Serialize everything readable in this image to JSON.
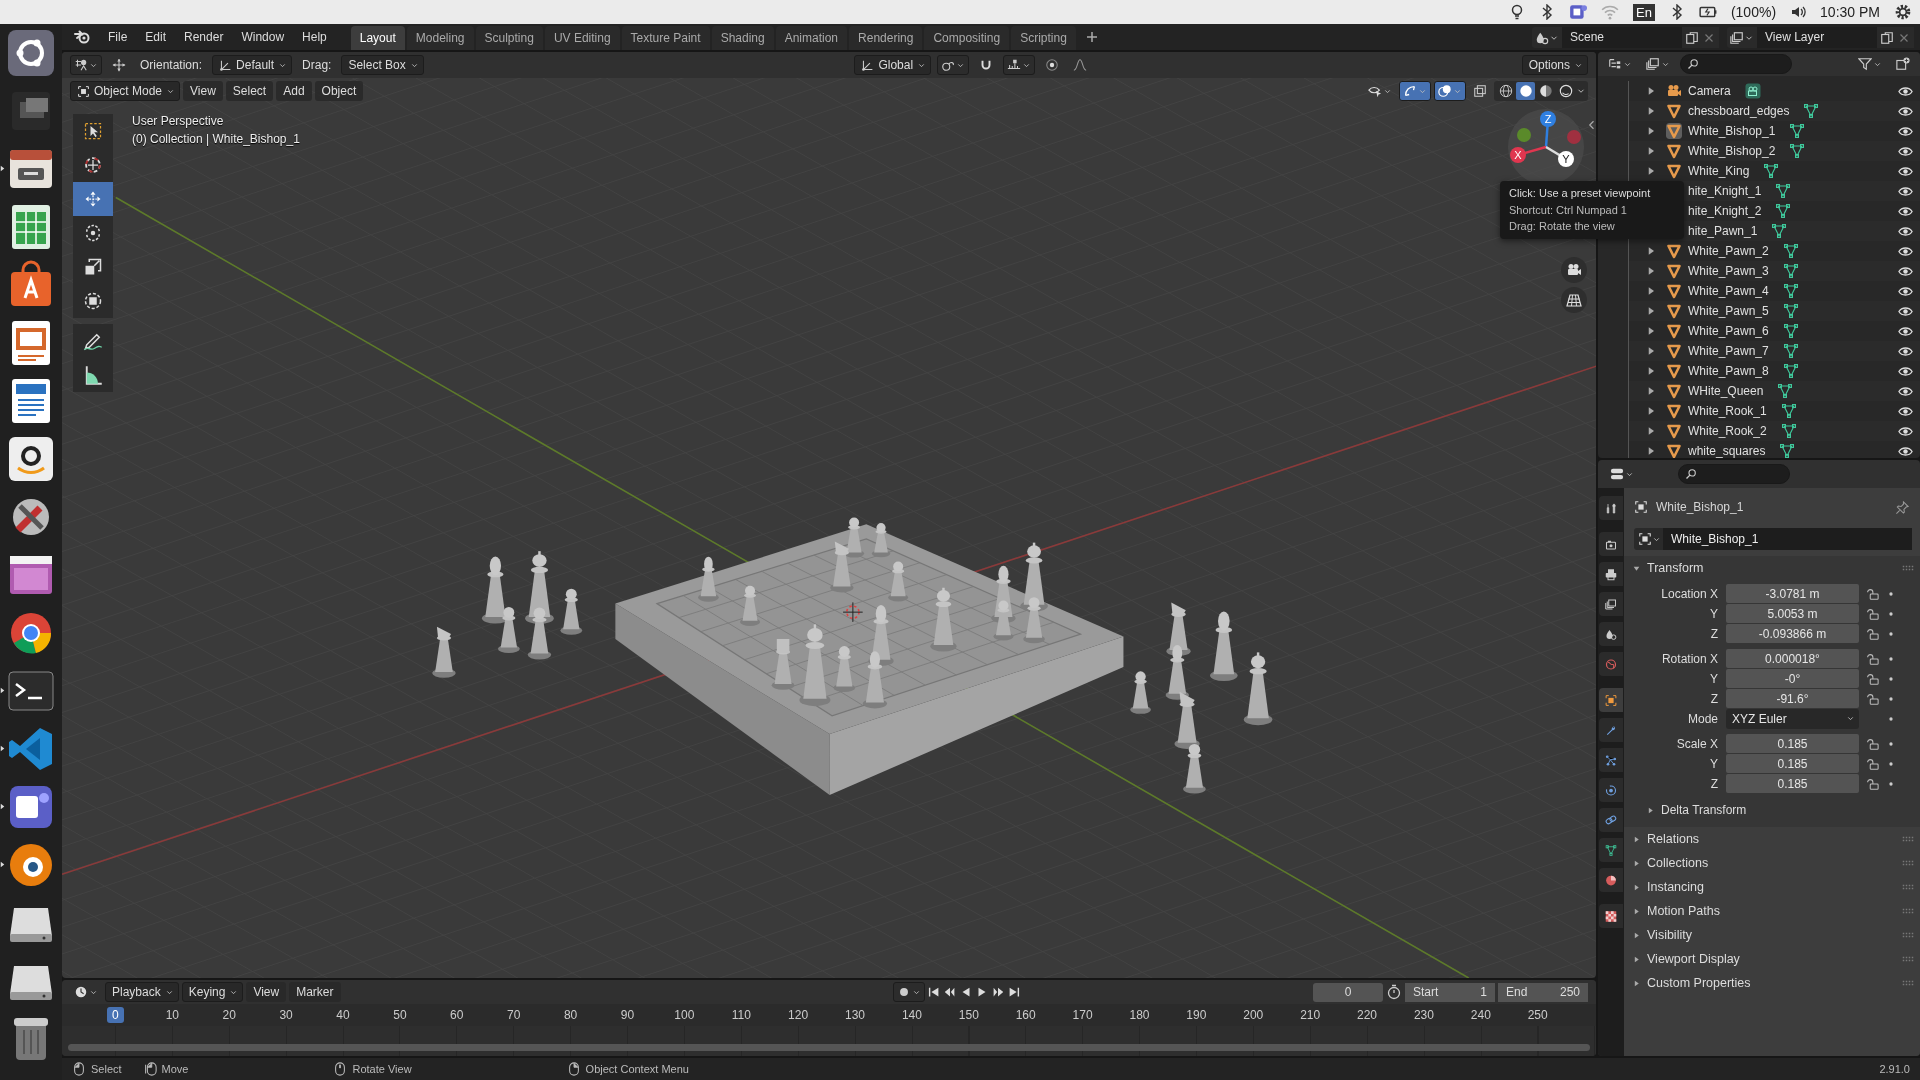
{
  "system_bar": {
    "keyboard": "En",
    "battery": "(100%)",
    "clock": "10:30 PM"
  },
  "dock": [
    {
      "kind": "ubuntu",
      "running": false
    },
    {
      "kind": "windows",
      "running": false
    },
    {
      "kind": "files",
      "running": true
    },
    {
      "kind": "calc",
      "running": false
    },
    {
      "kind": "software",
      "running": false
    },
    {
      "kind": "impress",
      "running": false
    },
    {
      "kind": "writer",
      "running": false
    },
    {
      "kind": "amazon",
      "running": false
    },
    {
      "kind": "settings",
      "running": false
    },
    {
      "kind": "purple",
      "running": false
    },
    {
      "kind": "chrome",
      "running": false
    },
    {
      "kind": "terminal",
      "running": true
    },
    {
      "kind": "vscode",
      "running": true
    },
    {
      "kind": "teams",
      "running": true
    },
    {
      "kind": "blender",
      "running": true
    },
    {
      "kind": "disk",
      "running": false
    },
    {
      "kind": "disk",
      "running": false
    },
    {
      "kind": "trash",
      "running": false
    }
  ],
  "menu": [
    "File",
    "Edit",
    "Render",
    "Window",
    "Help"
  ],
  "workspaces": [
    {
      "label": "Layout",
      "selected": true
    },
    {
      "label": "Modeling",
      "selected": false
    },
    {
      "label": "Sculpting",
      "selected": false
    },
    {
      "label": "UV Editing",
      "selected": false
    },
    {
      "label": "Texture Paint",
      "selected": false
    },
    {
      "label": "Shading",
      "selected": false
    },
    {
      "label": "Animation",
      "selected": false
    },
    {
      "label": "Rendering",
      "selected": false
    },
    {
      "label": "Compositing",
      "selected": false
    },
    {
      "label": "Scripting",
      "selected": false
    }
  ],
  "scene": "Scene",
  "view_layer": "View Layer",
  "tool_settings": {
    "orientation_label": "Orientation:",
    "orientation": "Default",
    "drag_label": "Drag:",
    "drag": "Select Box",
    "transform": "Global",
    "options": "Options"
  },
  "viewport_header": {
    "mode": "Object Mode",
    "menus": [
      "View",
      "Select",
      "Add",
      "Object"
    ],
    "shading": [
      {
        "kind": "wireframe",
        "selected": false
      },
      {
        "kind": "solid",
        "selected": true
      },
      {
        "kind": "material",
        "selected": false
      },
      {
        "kind": "rendered",
        "selected": false
      }
    ]
  },
  "viewport": {
    "info": [
      "User Perspective",
      "(0) Collection | White_Bishop_1"
    ],
    "tools": [
      {
        "kind": "select_box",
        "selected": false
      },
      {
        "kind": "cursor",
        "selected": false
      },
      {
        "kind": "move",
        "selected": true
      },
      {
        "kind": "rotate",
        "selected": false
      },
      {
        "kind": "scale",
        "selected": false
      },
      {
        "kind": "transform",
        "selected": false
      },
      {
        "kind": "annotate",
        "selected": false
      },
      {
        "kind": "measure",
        "selected": false
      }
    ],
    "gizmo": [
      {
        "kind": "z",
        "label": "Z"
      },
      {
        "kind": "x",
        "label": "X"
      },
      {
        "kind": "y",
        "label": "Y"
      }
    ]
  },
  "tooltip": [
    "Click: Use a preset viewpoint",
    "Shortcut: Ctrl Numpad 1",
    "Drag: Rotate the view"
  ],
  "outliner": {
    "items": [
      {
        "name": "Camera",
        "kind": "camera",
        "active": false,
        "covered": false,
        "visible": true
      },
      {
        "name": "chessboard_edges",
        "kind": "mesh",
        "active": false,
        "covered": false,
        "visible": true
      },
      {
        "name": "White_Bishop_1",
        "kind": "mesh",
        "active": true,
        "covered": false,
        "visible": true
      },
      {
        "name": "White_Bishop_2",
        "kind": "mesh",
        "active": false,
        "covered": false,
        "visible": true
      },
      {
        "name": "White_King",
        "kind": "mesh",
        "active": false,
        "covered": false,
        "visible": true
      },
      {
        "name": "hite_Knight_1",
        "kind": "mesh",
        "active": false,
        "covered": true,
        "visible": true
      },
      {
        "name": "hite_Knight_2",
        "kind": "mesh",
        "active": false,
        "covered": true,
        "visible": true
      },
      {
        "name": "hite_Pawn_1",
        "kind": "mesh",
        "active": false,
        "covered": true,
        "visible": true
      },
      {
        "name": "White_Pawn_2",
        "kind": "mesh",
        "active": false,
        "covered": false,
        "visible": true
      },
      {
        "name": "White_Pawn_3",
        "kind": "mesh",
        "active": false,
        "covered": false,
        "visible": true
      },
      {
        "name": "White_Pawn_4",
        "kind": "mesh",
        "active": false,
        "covered": false,
        "visible": true
      },
      {
        "name": "White_Pawn_5",
        "kind": "mesh",
        "active": false,
        "covered": false,
        "visible": true
      },
      {
        "name": "White_Pawn_6",
        "kind": "mesh",
        "active": false,
        "covered": false,
        "visible": true
      },
      {
        "name": "White_Pawn_7",
        "kind": "mesh",
        "active": false,
        "covered": false,
        "visible": true
      },
      {
        "name": "White_Pawn_8",
        "kind": "mesh",
        "active": false,
        "covered": false,
        "visible": true
      },
      {
        "name": "WHite_Queen",
        "kind": "mesh",
        "active": false,
        "covered": false,
        "visible": true
      },
      {
        "name": "White_Rook_1",
        "kind": "mesh",
        "active": false,
        "covered": false,
        "visible": true
      },
      {
        "name": "White_Rook_2",
        "kind": "mesh",
        "active": false,
        "covered": false,
        "visible": true
      },
      {
        "name": "white_squares",
        "kind": "mesh",
        "active": false,
        "covered": false,
        "visible": true
      }
    ]
  },
  "properties": {
    "tabs": [
      {
        "kind": "tool",
        "selected": false
      },
      {
        "kind": "render",
        "selected": false
      },
      {
        "kind": "output",
        "selected": false
      },
      {
        "kind": "view_layer",
        "selected": false
      },
      {
        "kind": "scene",
        "selected": false
      },
      {
        "kind": "world",
        "selected": false
      },
      {
        "kind": "object",
        "selected": true
      },
      {
        "kind": "modifiers",
        "selected": false
      },
      {
        "kind": "particles",
        "selected": false
      },
      {
        "kind": "physics",
        "selected": false
      },
      {
        "kind": "constraints",
        "selected": false
      },
      {
        "kind": "data",
        "selected": false
      },
      {
        "kind": "material",
        "selected": false
      },
      {
        "kind": "texture",
        "selected": false
      }
    ],
    "object": "White_Bishop_1",
    "datablock": "White_Bishop_1",
    "transform": {
      "title": "Transform",
      "expanded": true,
      "groups": [
        [
          {
            "kind": "field",
            "label": "Location X",
            "value": "-3.0781 m"
          },
          {
            "kind": "field",
            "label": "Y",
            "value": "5.0053 m"
          },
          {
            "kind": "field",
            "label": "Z",
            "value": "-0.093866 m"
          }
        ],
        [
          {
            "kind": "field",
            "label": "Rotation X",
            "value": "0.000018°"
          },
          {
            "kind": "field",
            "label": "Y",
            "value": "-0°"
          },
          {
            "kind": "field",
            "label": "Z",
            "value": "-91.6°"
          },
          {
            "kind": "dropdown",
            "label": "Mode",
            "value": "XYZ Euler"
          }
        ],
        [
          {
            "kind": "field",
            "label": "Scale X",
            "value": "0.185"
          },
          {
            "kind": "field",
            "label": "Y",
            "value": "0.185"
          },
          {
            "kind": "field",
            "label": "Z",
            "value": "0.185"
          }
        ]
      ],
      "subpanels": [
        {
          "title": "Delta Transform",
          "expanded": false
        }
      ]
    },
    "panels": [
      {
        "title": "Relations",
        "expanded": false
      },
      {
        "title": "Collections",
        "expanded": false
      },
      {
        "title": "Instancing",
        "expanded": false
      },
      {
        "title": "Motion Paths",
        "expanded": false
      },
      {
        "title": "Visibility",
        "expanded": false
      },
      {
        "title": "Viewport Display",
        "expanded": false
      },
      {
        "title": "Custom Properties",
        "expanded": false
      }
    ]
  },
  "timeline": {
    "menus": [
      {
        "label": "Playback",
        "kind": "dropdown"
      },
      {
        "label": "Keying",
        "kind": "dropdown"
      },
      {
        "label": "View",
        "kind": "menu"
      },
      {
        "label": "Marker",
        "kind": "menu"
      }
    ],
    "current": "0",
    "start_label": "Start",
    "start": "1",
    "end_label": "End",
    "end": "250",
    "playhead": "0",
    "ticks": [
      "10",
      "20",
      "30",
      "40",
      "50",
      "60",
      "70",
      "80",
      "90",
      "100",
      "110",
      "120",
      "130",
      "140",
      "150",
      "160",
      "170",
      "180",
      "190",
      "200",
      "210",
      "220",
      "230",
      "240",
      "250"
    ]
  },
  "status_bar": {
    "hints": [
      {
        "kind": "lmb",
        "text": "Select"
      },
      {
        "kind": "drag",
        "text": "Move"
      },
      {
        "kind": "mmb",
        "text": "Rotate View"
      },
      {
        "kind": "rmb",
        "text": "Object Context Menu"
      }
    ],
    "version": "2.91.0"
  }
}
